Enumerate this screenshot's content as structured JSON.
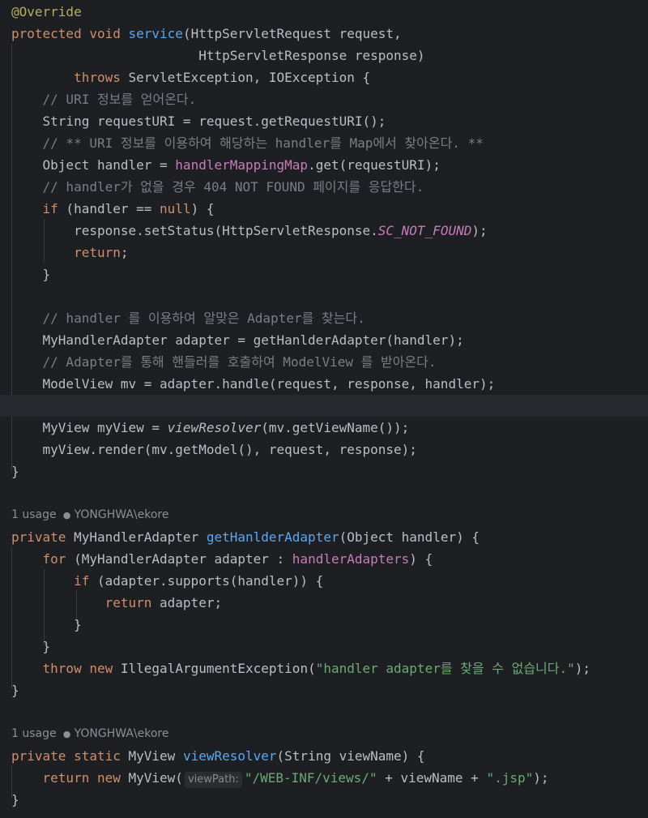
{
  "code": {
    "annotation": "@Override",
    "service_sig_mod": "protected void ",
    "service_name": "service",
    "service_params1": "(HttpServletRequest request,",
    "service_params2": "HttpServletResponse response)",
    "throws_kw": "throws",
    "throws_types": " ServletException, IOException {",
    "cmt_uri": "// URI 정보를 얻어온다.",
    "req_uri": "String requestURI = request.getRequestURI();",
    "cmt_find_handler": "// ** URI 정보를 이용하여 해당하는 handler를 Map에서 찾아온다. **",
    "handler_decl_pre": "Object handler = ",
    "handler_map": "handlerMappingMap",
    "handler_decl_post": ".get(requestURI);",
    "cmt_404": "// handler가 없을 경우 404 NOT FOUND 페이지를 응답한다.",
    "if_kw": "if",
    "if_cond": " (handler == ",
    "null_kw": "null",
    "if_end": ") {",
    "set_status_pre": "response.setStatus(HttpServletResponse.",
    "set_status_const": "SC_NOT_FOUND",
    "set_status_post": ");",
    "return_kw": "return",
    "return_end": ";",
    "close_brace": "}",
    "cmt_adapter_find": "// handler 를 이용하여 알맞은 Adapter를 찾는다.",
    "adapter_decl": "MyHandlerAdapter adapter = getHanlderAdapter(handler);",
    "cmt_adapter_call": "// Adapter를 통해 핸들러를 호출하여 ModelView 를 받아온다.",
    "mv_decl": "ModelView mv = adapter.handle(request, response, handler);",
    "myview_pre": "MyView myView = ",
    "myview_fn": "viewResolver",
    "myview_post": "(mv.getViewName());",
    "render": "myView.render(mv.getModel(), request, response);",
    "private_kw": "private",
    "get_adapter_ret": " MyHandlerAdapter ",
    "get_adapter_name": "getHanlderAdapter",
    "get_adapter_params": "(Object handler) {",
    "for_kw": "for",
    "for_mid": " (MyHandlerAdapter adapter : ",
    "handler_adapters": "handlerAdapters",
    "for_end": ") {",
    "if_supports": " (adapter.supports(handler)) {",
    "return_adapter": " adapter;",
    "throw_kw": "throw",
    "new_kw": "new",
    "illegal_pre": " IllegalArgumentException(",
    "illegal_str": "\"handler adapter를 찾을 수 없습니다.\"",
    "illegal_post": ");",
    "static_kw": "static",
    "resolver_ret": " MyView ",
    "resolver_name": "viewResolver",
    "resolver_params": "(String viewName) {",
    "myview_new": " MyView(",
    "hint_label": "viewPath:",
    "path_str": "\"/WEB-INF/views/\"",
    "path_mid": " + viewName + ",
    "ext_str": "\".jsp\"",
    "path_end": ");"
  },
  "inlay": {
    "usages": "1 usage",
    "author": "YONGHWA\\ekore"
  }
}
